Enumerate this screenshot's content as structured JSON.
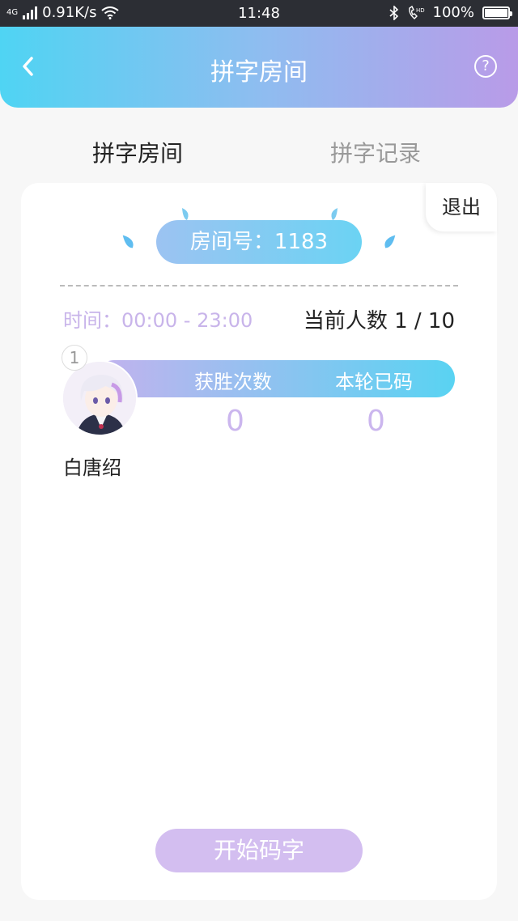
{
  "status_bar": {
    "network_type": "4G",
    "speed": "0.91K/s",
    "time": "11:48",
    "battery": "100%"
  },
  "header": {
    "title": "拼字房间",
    "back_icon": "chevron-left-icon",
    "help_icon": "question-circle-icon",
    "help_glyph": "?"
  },
  "tabs": [
    {
      "label": "拼字房间",
      "active": true
    },
    {
      "label": "拼字记录",
      "active": false
    }
  ],
  "room": {
    "exit_label": "退出",
    "room_number_text": "房间号：1183",
    "time_text": "时间：00:00 - 23:00",
    "player_count_text": "当前人数 1 / 10"
  },
  "player": {
    "rank": "1",
    "name": "白唐绍",
    "stats": [
      {
        "label": "获胜次数",
        "value": "0"
      },
      {
        "label": "本轮已码",
        "value": "0"
      }
    ]
  },
  "start_button_label": "开始码字",
  "colors": {
    "gradient_start": "#4fd4f3",
    "gradient_end": "#b99be8",
    "accent_purple": "#cbb6ee",
    "start_button": "#d3bef0"
  }
}
